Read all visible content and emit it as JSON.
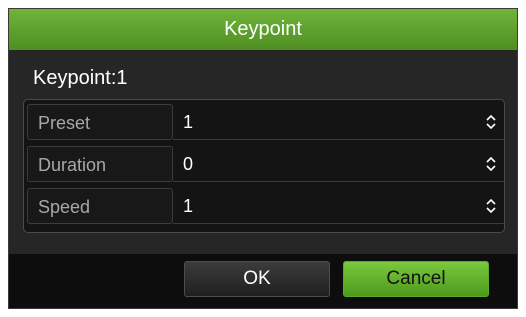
{
  "dialog": {
    "title": "Keypoint",
    "subtitle": "Keypoint:1",
    "fields": [
      {
        "label": "Preset",
        "value": "1",
        "icon": "spinner-updown-icon"
      },
      {
        "label": "Duration",
        "value": "0",
        "icon": "spinner-updown-icon"
      },
      {
        "label": "Speed",
        "value": "1",
        "icon": "spinner-updown-icon"
      }
    ],
    "buttons": {
      "ok_label": "OK",
      "cancel_label": "Cancel"
    }
  },
  "colors": {
    "title_bar": "#5fa42e",
    "dialog_background": "#262626",
    "cancel_button": "#6bb832"
  }
}
